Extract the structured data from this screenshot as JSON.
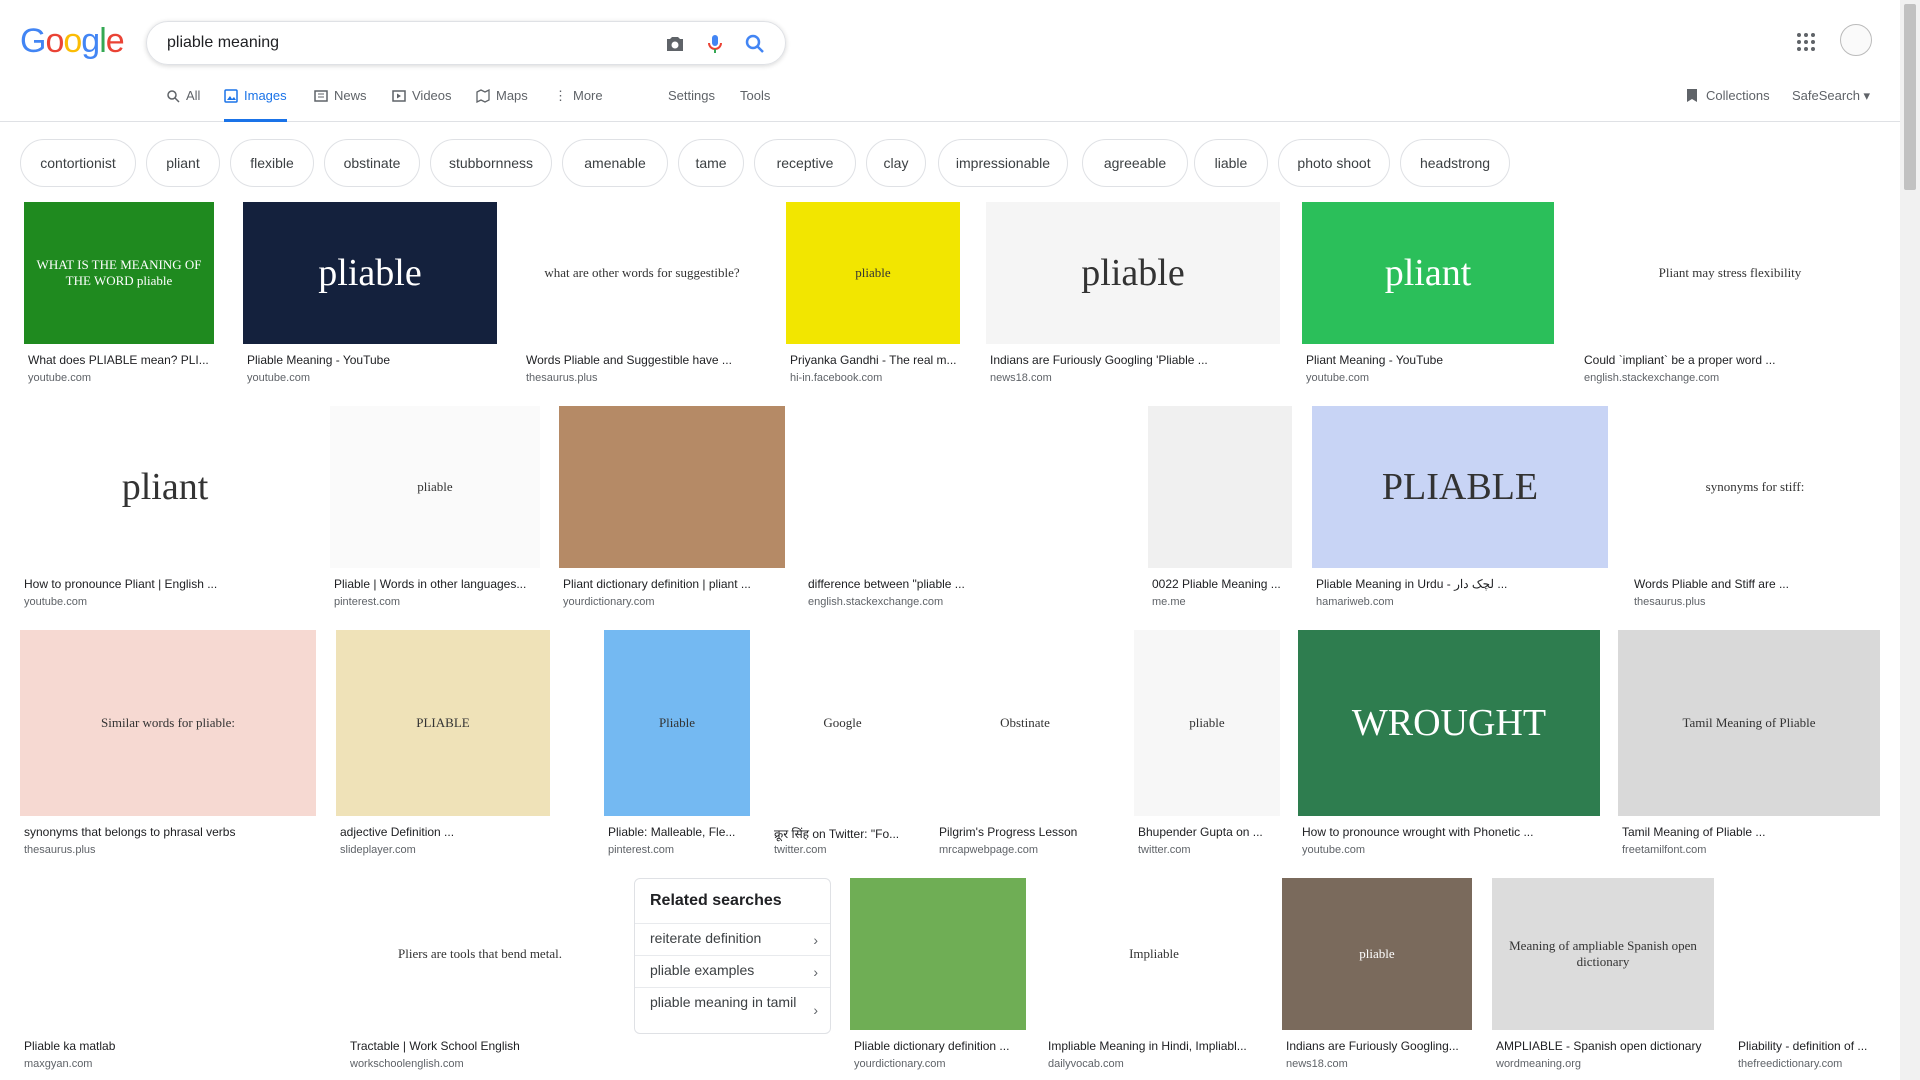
{
  "logo": {
    "letters": [
      "G",
      "o",
      "o",
      "g",
      "l",
      "e"
    ],
    "colors": [
      "#4285F4",
      "#EA4335",
      "#FBBC05",
      "#4285F4",
      "#34A853",
      "#EA4335"
    ]
  },
  "search": {
    "query": "pliable meaning"
  },
  "nav": {
    "tabs": [
      {
        "label": "All",
        "icon": "search-icon"
      },
      {
        "label": "Images",
        "icon": "image-icon",
        "active": true
      },
      {
        "label": "News",
        "icon": "news-icon"
      },
      {
        "label": "Videos",
        "icon": "video-icon"
      },
      {
        "label": "Maps",
        "icon": "map-icon"
      },
      {
        "label": "More",
        "icon": "more-icon"
      }
    ],
    "settings": "Settings",
    "tools": "Tools",
    "collections": "Collections",
    "safesearch": "SafeSearch ▾"
  },
  "chips": [
    "contortionist",
    "pliant",
    "flexible",
    "obstinate",
    "stubbornness",
    "amenable",
    "tame",
    "receptive",
    "clay",
    "impressionable",
    "agreeable",
    "liable",
    "photo shoot",
    "headstrong"
  ],
  "results": [
    {
      "caption": "What does PLIABLE mean? PLI...",
      "source": "youtube.com",
      "thumb_text": "WHAT IS THE MEANING OF THE WORD pliable",
      "bg": "#1f8a1f"
    },
    {
      "caption": "Pliable Meaning - YouTube",
      "source": "youtube.com",
      "thumb_text": "pliable",
      "bg": "#14213d"
    },
    {
      "caption": "Words Pliable and Suggestible have ...",
      "source": "thesaurus.plus",
      "thumb_text": "what are other words for suggestible?",
      "bg": "#ffffff"
    },
    {
      "caption": "Priyanka Gandhi - The real m...",
      "source": "hi-in.facebook.com",
      "thumb_text": "pliable",
      "bg": "#f2e600"
    },
    {
      "caption": "Indians are Furiously Googling 'Pliable ...",
      "source": "news18.com",
      "thumb_text": "pliable",
      "bg": "#f5f5f5"
    },
    {
      "caption": "Pliant Meaning - YouTube",
      "source": "youtube.com",
      "thumb_text": "pliant",
      "bg": "#2bbf5a"
    },
    {
      "caption": "Could `impliant` be a proper word ...",
      "source": "english.stackexchange.com",
      "thumb_text": "Pliant may stress flexibility",
      "bg": "#ffffff"
    },
    {
      "caption": "How to pronounce Pliant | English ...",
      "source": "youtube.com",
      "thumb_text": "pliant",
      "bg": "#ffffff"
    },
    {
      "caption": "Pliable | Words in other languages...",
      "source": "pinterest.com",
      "thumb_text": "pliable",
      "bg": "#fafafa"
    },
    {
      "caption": "Pliant dictionary definition | pliant ...",
      "source": "yourdictionary.com",
      "thumb_text": "",
      "bg": "#b58a66"
    },
    {
      "caption": "difference between \"pliable ...",
      "source": "english.stackexchange.com",
      "thumb_text": "",
      "bg": "#ffffff"
    },
    {
      "caption": "0022 Pliable Meaning ...",
      "source": "me.me",
      "thumb_text": "",
      "bg": "#f0f0f0"
    },
    {
      "caption": "Pliable Meaning in Urdu - لچک دار ...",
      "source": "hamariweb.com",
      "thumb_text": "PLIABLE",
      "bg": "#c8d4f5"
    },
    {
      "caption": "Words Pliable and Stiff are ...",
      "source": "thesaurus.plus",
      "thumb_text": "synonyms for stiff:",
      "bg": "#ffffff"
    },
    {
      "caption": "synonyms that belongs to phrasal verbs",
      "source": "thesaurus.plus",
      "thumb_text": "Similar words for pliable:",
      "bg": "#f6d9d2"
    },
    {
      "caption": "adjective Definition ...",
      "source": "slideplayer.com",
      "thumb_text": "PLIABLE",
      "bg": "#efe2b8"
    },
    {
      "caption": "Pliable: Malleable, Fle...",
      "source": "pinterest.com",
      "thumb_text": "Pliable",
      "bg": "#74b9f2"
    },
    {
      "caption": "क्रूर सिंह on Twitter: \"Fo...",
      "source": "twitter.com",
      "thumb_text": "Google",
      "bg": "#ffffff"
    },
    {
      "caption": "Pilgrim's Progress Lesson",
      "source": "mrcapwebpage.com",
      "thumb_text": "Obstinate",
      "bg": "#ffffff"
    },
    {
      "caption": "Bhupender Gupta on ...",
      "source": "twitter.com",
      "thumb_text": "pliable",
      "bg": "#f7f7f7"
    },
    {
      "caption": "How to pronounce wrought with Phonetic ...",
      "source": "youtube.com",
      "thumb_text": "WROUGHT",
      "bg": "#2e7d4f"
    },
    {
      "caption": "Tamil Meaning of Pliable ...",
      "source": "freetamilfont.com",
      "thumb_text": "Tamil Meaning of Pliable",
      "bg": "#d9d9d9"
    },
    {
      "caption": "Pliable ka matlab",
      "source": "maxgyan.com",
      "thumb_text": "",
      "bg": "#ffffff"
    },
    {
      "caption": "Tractable | Work School English",
      "source": "workschoolenglish.com",
      "thumb_text": "Pliers are tools that bend metal.",
      "bg": "#ffffff"
    },
    {
      "caption": "Pliable dictionary definition ...",
      "source": "yourdictionary.com",
      "thumb_text": "",
      "bg": "#6fae55"
    },
    {
      "caption": "Impliable Meaning in Hindi, Impliabl...",
      "source": "dailyvocab.com",
      "thumb_text": "Impliable",
      "bg": "#ffffff"
    },
    {
      "caption": "Indians are Furiously Googling...",
      "source": "news18.com",
      "thumb_text": "pliable",
      "bg": "#7a6a5c"
    },
    {
      "caption": "AMPLIABLE - Spanish open dictionary",
      "source": "wordmeaning.org",
      "thumb_text": "Meaning of ampliable Spanish open dictionary",
      "bg": "#dcdcdc"
    },
    {
      "caption": "Pliability - definition of ...",
      "source": "thefreedictionary.com",
      "thumb_text": "",
      "bg": "#ffffff"
    }
  ],
  "related": {
    "title": "Related searches",
    "items": [
      "reiterate definition",
      "pliable examples",
      "pliable meaning in tamil"
    ]
  }
}
